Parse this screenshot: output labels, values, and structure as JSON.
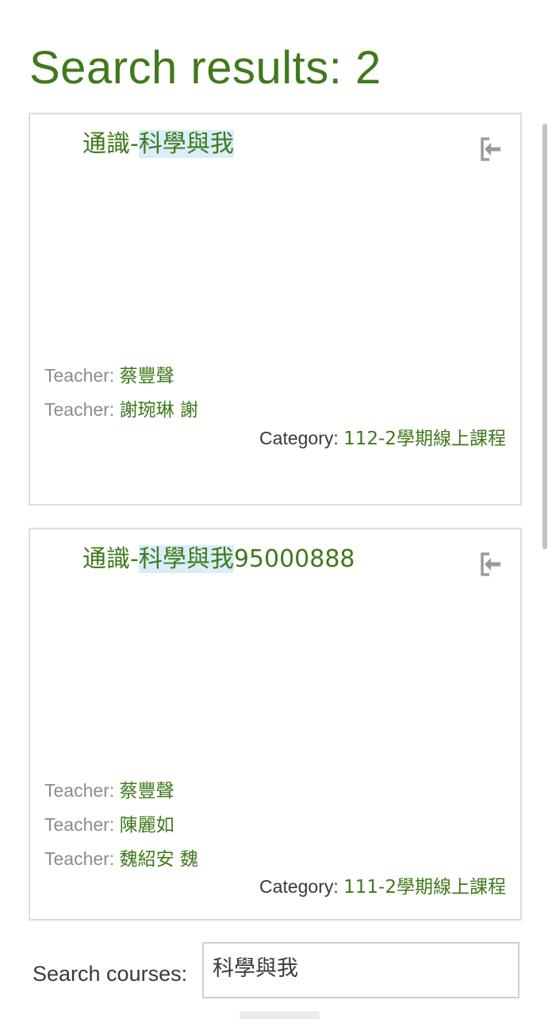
{
  "page": {
    "title": "Search results: 2"
  },
  "courses": [
    {
      "name_prefix": "通識-",
      "name_highlight": "科學與我",
      "name_suffix": "",
      "enrol_icon": "sign-in-icon",
      "teachers": [
        {
          "label": "Teacher: ",
          "name": "蔡豐聲"
        },
        {
          "label": "Teacher: ",
          "name": "謝琬琳 謝"
        }
      ],
      "category_label": "Category: ",
      "category_name": "112-2學期線上課程"
    },
    {
      "name_prefix": "通識-",
      "name_highlight": "科學與我",
      "name_suffix": "95000888",
      "enrol_icon": "sign-in-icon",
      "teachers": [
        {
          "label": "Teacher: ",
          "name": "蔡豐聲"
        },
        {
          "label": "Teacher: ",
          "name": "陳麗如"
        },
        {
          "label": "Teacher: ",
          "name": "魏紹安 魏"
        }
      ],
      "category_label": "Category: ",
      "category_name": "111-2學期線上課程"
    }
  ],
  "search": {
    "label": "Search courses:",
    "value": "科學與我"
  },
  "colors": {
    "accent": "#3f7a1c",
    "highlight": "#d9eef8",
    "muted": "#868e96",
    "border": "#dcdcdc"
  }
}
